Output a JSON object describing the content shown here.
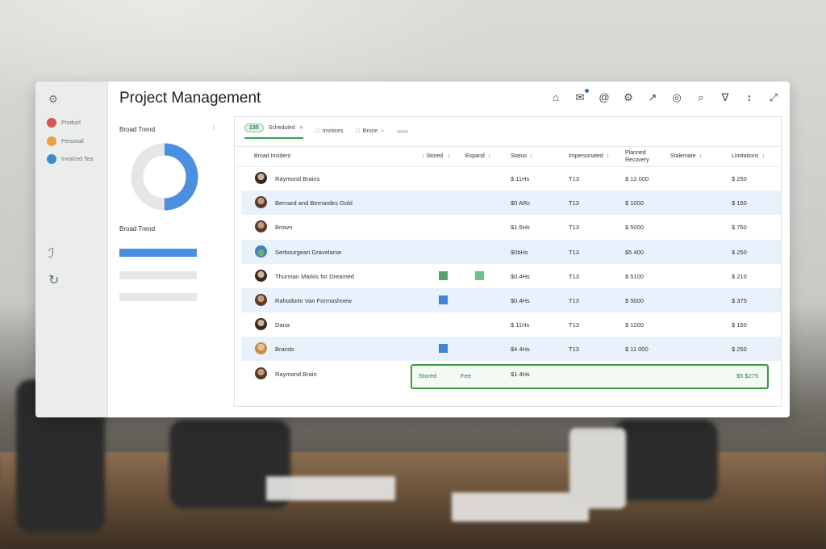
{
  "app": {
    "title": "Project Management"
  },
  "rail": {
    "items": [
      {
        "label": "Product",
        "color": "#d9534f"
      },
      {
        "label": "Personal",
        "color": "#e8a33c"
      },
      {
        "label": "Invoiced Tea",
        "color": "#3b8ec7"
      }
    ]
  },
  "left": {
    "chart_title": "Broad Trend",
    "menu_marker": "⁞",
    "section_label": "Broad Trend",
    "donut_fraction": 0.5,
    "colors": {
      "donut_fill": "#4a8fe0",
      "donut_track": "#e6e6e6",
      "bar_active": "#4a8fe0",
      "bar_idle": "#e7e7e7"
    }
  },
  "table": {
    "tabs": [
      {
        "pill": "135",
        "label": "Scheduled",
        "suffix": "≈"
      },
      {
        "label": "Invoices",
        "suffix": ""
      },
      {
        "label": "Bruce",
        "suffix": "≈"
      }
    ],
    "headers": [
      "Broad Incident",
      "Stored",
      "Expand",
      "Status",
      "Impersonated",
      "Planned Recovery",
      "Stalemate",
      "Limitations"
    ],
    "rows": [
      {
        "name": "Raymond Brains",
        "status": "$ 11Hs",
        "imp": "T13",
        "planned": "$ 12 000",
        "limit": "$ 250",
        "alt": false,
        "avatar": "dark",
        "marks": []
      },
      {
        "name": "Bernard and Bernardes Gold",
        "status": "$0 ARc",
        "imp": "T13",
        "planned": "$ 1000",
        "limit": "$ 150",
        "alt": true,
        "avatar": "",
        "marks": []
      },
      {
        "name": "Brown",
        "status": "$1.5Hs",
        "imp": "T13",
        "planned": "$ 5000",
        "limit": "$ 750",
        "alt": false,
        "avatar": "",
        "marks": []
      },
      {
        "name": "Serbourgean Gravelarse",
        "status": "$0bHs",
        "imp": "T13",
        "planned": "$5 400",
        "limit": "$ 250",
        "alt": true,
        "avatar": "land",
        "marks": []
      },
      {
        "name": "Thurman Markis for Dreamed",
        "status": "$0.4Hs",
        "imp": "T13",
        "planned": "$ 5100",
        "limit": "$ 210",
        "alt": false,
        "avatar": "dark",
        "marks": [
          "#4fa56a",
          "#6fbe8d"
        ]
      },
      {
        "name": "Rahodorin Van Formoshnew",
        "status": "$0.4Hs",
        "imp": "T13",
        "planned": "$ 5000",
        "limit": "$ 375",
        "alt": true,
        "avatar": "",
        "marks": [
          "#3f84d7"
        ]
      },
      {
        "name": "Dana",
        "status": "$ 11Hs",
        "imp": "T13",
        "planned": "$ 1200",
        "limit": "$ 150",
        "alt": false,
        "avatar": "dark",
        "marks": []
      },
      {
        "name": "Brands",
        "status": "$4 4Hs",
        "imp": "T13",
        "planned": "$ 11 000",
        "limit": "$ 250",
        "alt": true,
        "avatar": "blond",
        "marks": [
          "#3f84d7"
        ]
      },
      {
        "name": "Raymond Brain",
        "status": "$1 4Hs",
        "imp": "",
        "planned": "",
        "limit": "",
        "alt": false,
        "avatar": "",
        "marks": [],
        "highlight": {
          "tag1": "Stored",
          "tag2": "Fee",
          "right": "$5 $275"
        }
      }
    ]
  },
  "colors": {
    "accent_green": "#3a9a45",
    "row_alt": "#e9f1fd",
    "accent_blue": "#4a8fe0"
  }
}
